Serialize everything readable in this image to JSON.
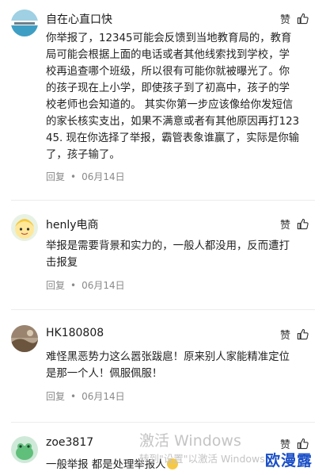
{
  "comments": [
    {
      "username": "自在心直口快",
      "like_label": "赞",
      "content_lines": [
        "你举报了，12345可能会反馈到当地教育局的，教育",
        "局可能会根据上面的电话或者其他线索找到学校，学",
        "校再追查哪个班级，所以很有可能你就被曝光了。你",
        "的孩子现在上小学，即使孩子到了初高中，孩子的学",
        "校老师也会知道的。 其实你第一步应该像给你发短信",
        "的家长核实支出，如果不满意或者有其他原因再打123",
        "45. 现在你选择了举报，霸管表象谁赢了，实际是你输",
        "了，孩子输了。"
      ],
      "reply_label": "回复",
      "date": "06月14日"
    },
    {
      "username": "henly电商",
      "like_label": "赞",
      "content_lines": [
        "举报是需要背景和实力的，一般人都没用，反而遭打",
        "击报复"
      ],
      "reply_label": "回复",
      "date": "06月14日"
    },
    {
      "username": "HK180808",
      "like_label": "赞",
      "content_lines": [
        "难怪黑恶势力这么嚣张跋扈！原来别人家能精准定位",
        "是那一个人！佩服佩服！"
      ],
      "reply_label": "回复",
      "date": "06月14日"
    },
    {
      "username": "zoe3817",
      "like_label": "赞",
      "content_lines": [
        "一般举报 都是处理举报人"
      ]
    }
  ],
  "overlay": {
    "watermark_title": "激活 Windows",
    "watermark_sub": "转到\"设置\"以激活 Windows。",
    "brand_logo": "欧漫露"
  }
}
